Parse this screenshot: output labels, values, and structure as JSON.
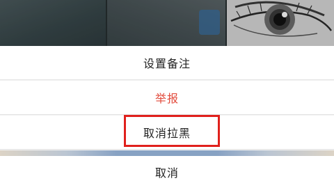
{
  "menu": {
    "items": [
      {
        "label": "设置备注"
      },
      {
        "label": "举报"
      },
      {
        "label": "取消拉黑"
      }
    ],
    "cancel_label": "取消"
  },
  "colors": {
    "report_text": "#e24a3b",
    "highlight": "#e0201c"
  }
}
